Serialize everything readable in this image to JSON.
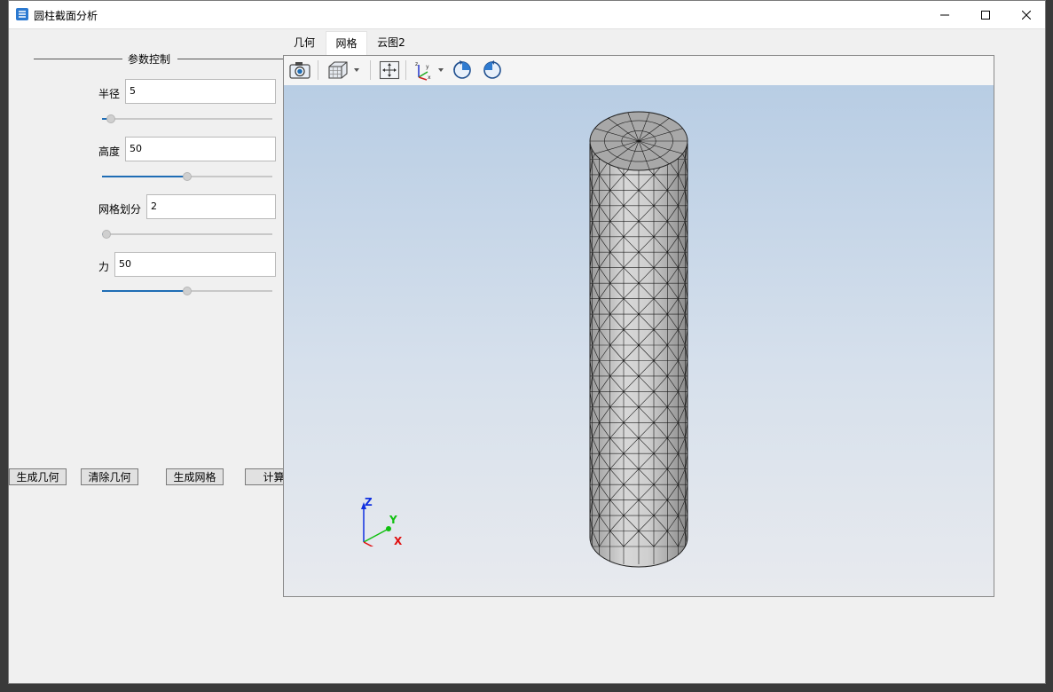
{
  "window": {
    "title": "圆柱截面分析"
  },
  "params": {
    "group_title": "参数控制",
    "radius": {
      "label": "半径",
      "value": "5",
      "slider_fraction": 0.03
    },
    "height": {
      "label": "高度",
      "value": "50",
      "slider_fraction": 0.5
    },
    "mesh": {
      "label": "网格划分",
      "value": "2",
      "slider_fraction": 0.0
    },
    "force": {
      "label": "力",
      "value": "50",
      "slider_fraction": 0.5
    }
  },
  "buttons": {
    "generate_geometry": "生成几何",
    "clear_geometry": "清除几何",
    "generate_mesh": "生成网格",
    "compute": "计算"
  },
  "tabs": [
    {
      "label": "几何"
    },
    {
      "label": "网格",
      "active": true
    },
    {
      "label": "云图2"
    }
  ],
  "toolbar": {
    "icons": [
      "camera-icon",
      "cube-view-icon",
      "fit-view-icon",
      "axes-icon",
      "rotate-cw-icon",
      "rotate-ccw-icon"
    ]
  },
  "axes": {
    "z": "Z",
    "y": "Y",
    "x": "X"
  },
  "colors": {
    "slider_fill": "#1f6db5",
    "axis_x": "#e01010",
    "axis_y": "#10c010",
    "axis_z": "#1030e0",
    "mesh_face": "#c8c8c8"
  }
}
